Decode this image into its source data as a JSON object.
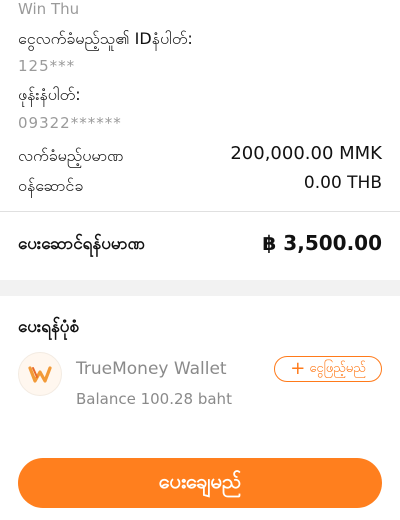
{
  "account_name": "Win Thu",
  "details": {
    "user_id_label": "ငွေလက်ခံမည့်သူ၏ IDနံပါတ်:",
    "user_id_value": "125***",
    "phone_label": "ဖုန်းနံပါတ်:",
    "phone_value": "09322******",
    "received_amount_label": "လက်ခံမည့်ပမာဏ",
    "received_amount_value": "200,000.00 MMK",
    "fee_label": "ဝန်ဆောင်ခ",
    "fee_value": "0.00 THB"
  },
  "total": {
    "label": "ပေးဆောင်ရန်ပမာဏ",
    "value": "฿ 3,500.00"
  },
  "payment_method": {
    "section_title": "ပေးရန်ပုံစံ",
    "wallet_name": "TrueMoney Wallet",
    "balance": "Balance 100.28 baht",
    "topup_label": "ငွေဖြည့်မည်",
    "topup_icon": "plus-icon"
  },
  "pay_button_label": "ပေးချေမည်",
  "colors": {
    "accent": "#ff7f1e",
    "logo_accent": "#f29a38"
  }
}
